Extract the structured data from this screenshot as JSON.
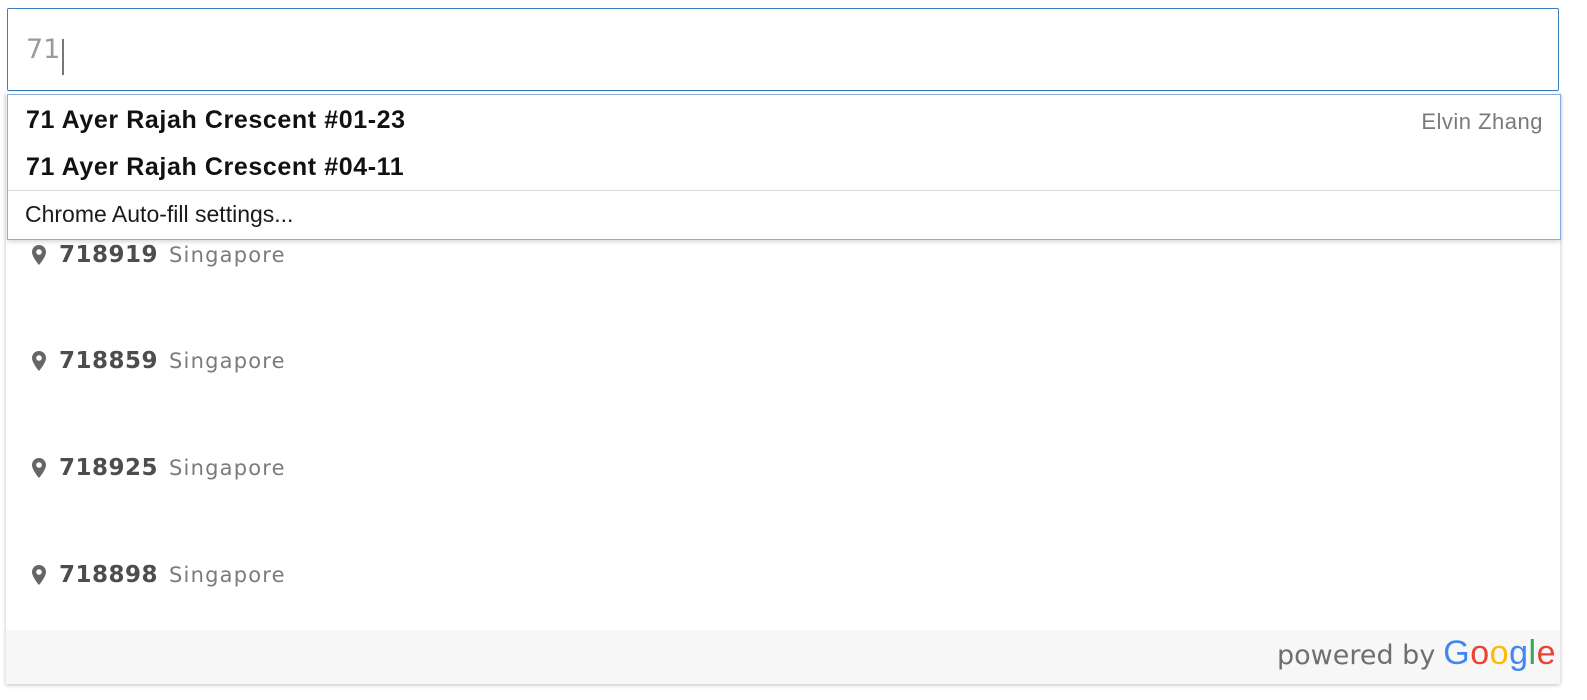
{
  "search": {
    "value": "71"
  },
  "autofill": {
    "suggestions": [
      {
        "value": "71 Ayer Rajah Crescent #01-23",
        "label": "Elvin Zhang"
      },
      {
        "value": "71 Ayer Rajah Crescent #04-11",
        "label": ""
      }
    ],
    "settings_label": "Chrome Auto-fill settings..."
  },
  "places": {
    "items": [
      {
        "main": "718919",
        "secondary": "Singapore",
        "icon": "map-pin-icon"
      },
      {
        "main": "718859",
        "secondary": "Singapore",
        "icon": "map-pin-icon"
      },
      {
        "main": "718925",
        "secondary": "Singapore",
        "icon": "map-pin-icon"
      },
      {
        "main": "718898",
        "secondary": "Singapore",
        "icon": "map-pin-icon"
      }
    ],
    "powered_by": "powered by",
    "google_logo": {
      "letters": [
        "G",
        "o",
        "o",
        "g",
        "l",
        "e"
      ],
      "colors": [
        "#4285F4",
        "#EA4335",
        "#FBBC05",
        "#4285F4",
        "#34A853",
        "#EA4335"
      ]
    }
  }
}
